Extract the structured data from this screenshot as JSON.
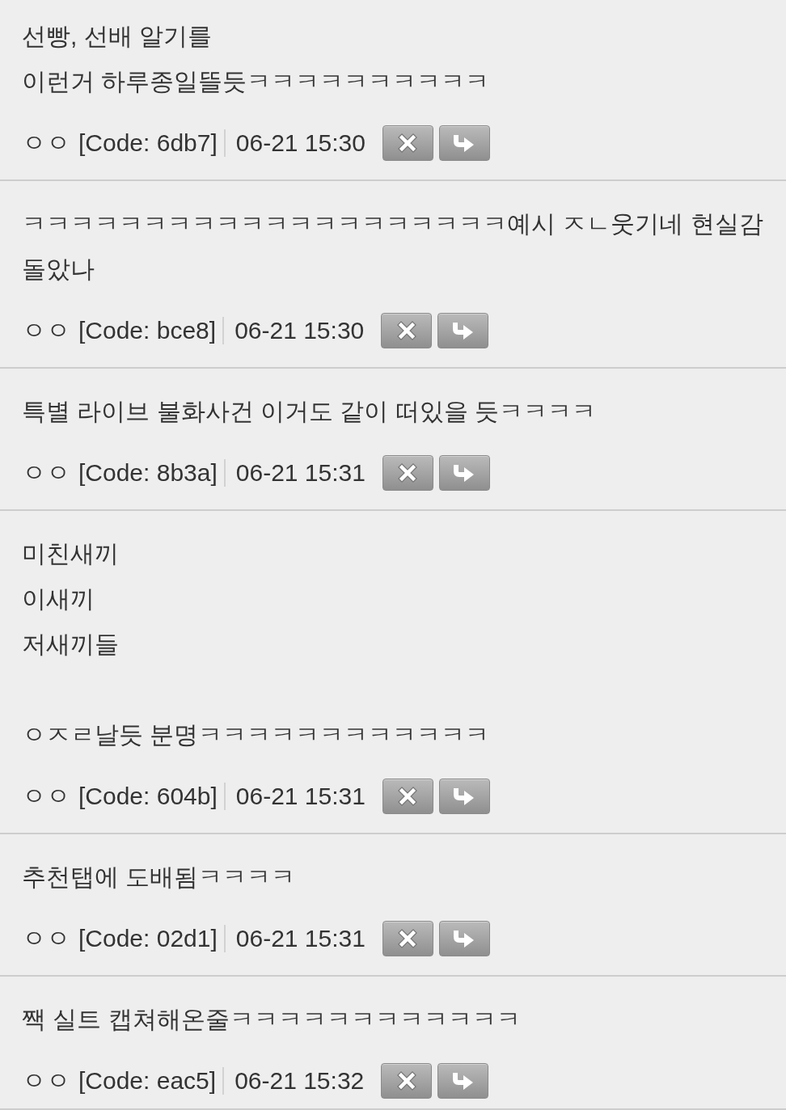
{
  "comments": [
    {
      "body": [
        [
          "선빵, 선배 알기를",
          "이런거 하루종일뜰듯ㅋㅋㅋㅋㅋㅋㅋㅋㅋㅋ"
        ]
      ],
      "author": "ㅇㅇ",
      "code": "[Code: 6db7]",
      "time": "06-21 15:30"
    },
    {
      "body": [
        [
          "ㅋㅋㅋㅋㅋㅋㅋㅋㅋㅋㅋㅋㅋㅋㅋㅋㅋㅋㅋㅋ예시 ㅈㄴ웃기네 현실감",
          "돌았나"
        ]
      ],
      "author": "ㅇㅇ",
      "code": "[Code: bce8]",
      "time": "06-21 15:30"
    },
    {
      "body": [
        [
          "특별 라이브 불화사건 이거도 같이 떠있을 듯ㅋㅋㅋㅋ"
        ]
      ],
      "author": "ㅇㅇ",
      "code": "[Code: 8b3a]",
      "time": "06-21 15:31"
    },
    {
      "body": [
        [
          "미친새끼",
          "이새끼",
          "저새끼들"
        ],
        [
          "ㅇㅈㄹ날듯 분명ㅋㅋㅋㅋㅋㅋㅋㅋㅋㅋㅋㅋ"
        ]
      ],
      "author": "ㅇㅇ",
      "code": "[Code: 604b]",
      "time": "06-21 15:31"
    },
    {
      "body": [
        [
          "추천탭에 도배됨ㅋㅋㅋㅋ"
        ]
      ],
      "author": "ㅇㅇ",
      "code": "[Code: 02d1]",
      "time": "06-21 15:31"
    },
    {
      "body": [
        [
          "짹 실트 캡쳐해온줄ㅋㅋㅋㅋㅋㅋㅋㅋㅋㅋㅋㅋ"
        ]
      ],
      "author": "ㅇㅇ",
      "code": "[Code: eac5]",
      "time": "06-21 15:32"
    }
  ]
}
